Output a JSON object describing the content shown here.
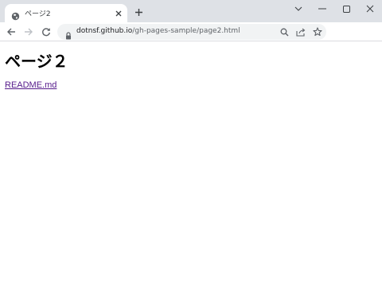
{
  "tab": {
    "title": "ページ2",
    "favicon": "globe-icon"
  },
  "toolbar": {
    "url_host": "dotnsf.github.io",
    "url_path": "/gh-pages-sample/page2.html"
  },
  "page": {
    "heading": "ページ２",
    "link_text": "README.md"
  },
  "colors": {
    "titlebar": "#dee1e6",
    "visited_link": "#551a8b",
    "omnibox": "#f1f3f4"
  }
}
